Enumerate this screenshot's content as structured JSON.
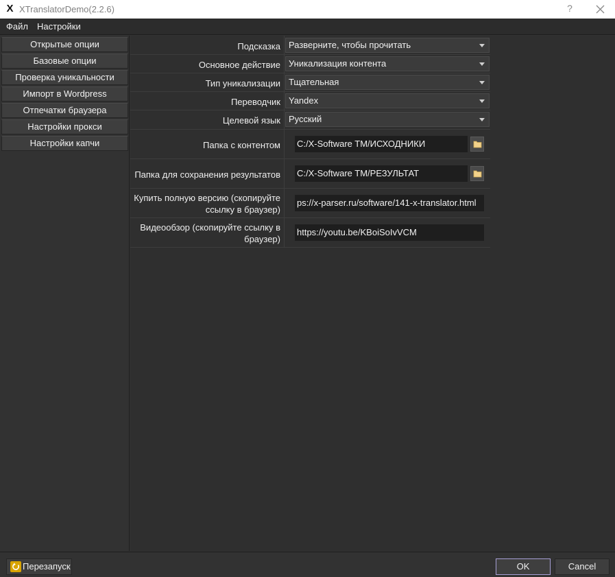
{
  "window": {
    "title": "XTranslatorDemo(2.2.6)",
    "logo_letter": "X",
    "help_symbol": "?"
  },
  "menu": {
    "items": [
      {
        "label": "Файл"
      },
      {
        "label": "Настройки"
      }
    ]
  },
  "sidebar": {
    "items": [
      {
        "label": "Открытые опции"
      },
      {
        "label": "Базовые опции"
      },
      {
        "label": "Проверка уникальности"
      },
      {
        "label": "Импорт в Wordpress"
      },
      {
        "label": "Отпечатки браузера"
      },
      {
        "label": "Настройки прокси"
      },
      {
        "label": "Настройки капчи"
      }
    ]
  },
  "form": {
    "hint": {
      "label": "Подсказка",
      "value": "Разверните, чтобы прочитать"
    },
    "main_action": {
      "label": "Основное действие",
      "value": "Уникализация контента"
    },
    "uniq_type": {
      "label": "Тип уникализации",
      "value": "Тщательная"
    },
    "translator": {
      "label": "Переводчик",
      "value": "Yandex"
    },
    "target_lang": {
      "label": "Целевой язык",
      "value": "Русский"
    },
    "content_folder": {
      "label": "Папка с контентом",
      "value": "C:/X-Software TM/ИСХОДНИКИ"
    },
    "results_folder": {
      "label": "Папка для сохранения результатов",
      "value": "C:/X-Software TM/РЕЗУЛЬТАТ"
    },
    "buy_full": {
      "label_line1": "Купить полную версию (скопируйте",
      "label_line2": "ссылку в браузер)",
      "value": "ps://x-parser.ru/software/141-x-translator.html"
    },
    "video": {
      "label_line1": "Видеообзор (скопируйте ссылку в",
      "label_line2": "браузер)",
      "value": "https://youtu.be/KBoiSoIvVCM"
    }
  },
  "bottom": {
    "restart_label": "Перезапуск",
    "ok_label": "OK",
    "cancel_label": "Cancel"
  },
  "colors": {
    "background": "#323232",
    "field_bg": "#1e1e1e",
    "ok_border": "#a79fd6",
    "restart_icon": "#d9a400"
  }
}
